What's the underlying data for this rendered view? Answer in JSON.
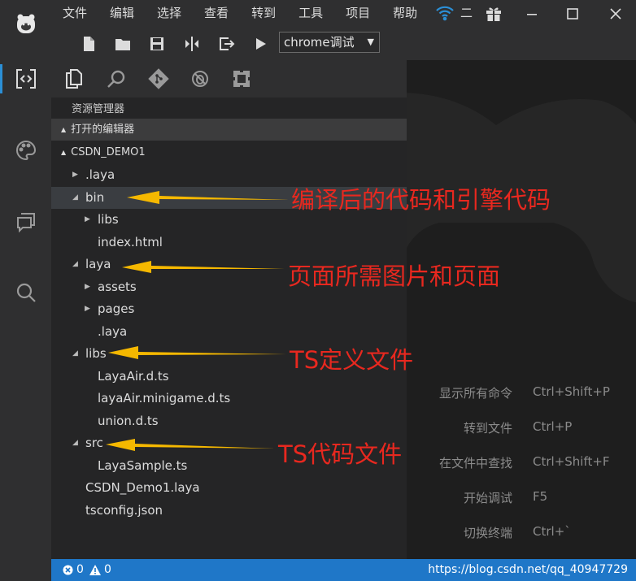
{
  "menu": [
    "文件",
    "编辑",
    "选择",
    "查看",
    "转到",
    "工具",
    "项目",
    "帮助"
  ],
  "title_extra": "二",
  "toolbar": {
    "run_config": "chrome调试"
  },
  "explorer": {
    "title": "资源管理器",
    "open_editors": "打开的编辑器",
    "project": "CSDN_DEMO1",
    "tree": [
      {
        "label": ".laya",
        "depth": 0,
        "caret": "closed"
      },
      {
        "label": "bin",
        "depth": 0,
        "caret": "open",
        "selected": true
      },
      {
        "label": "libs",
        "depth": 1,
        "caret": "closed"
      },
      {
        "label": "index.html",
        "depth": 1,
        "caret": "none"
      },
      {
        "label": "laya",
        "depth": 0,
        "caret": "open"
      },
      {
        "label": "assets",
        "depth": 1,
        "caret": "closed"
      },
      {
        "label": "pages",
        "depth": 1,
        "caret": "closed"
      },
      {
        "label": ".laya",
        "depth": 1,
        "caret": "none"
      },
      {
        "label": "libs",
        "depth": 0,
        "caret": "open"
      },
      {
        "label": "LayaAir.d.ts",
        "depth": 1,
        "caret": "none"
      },
      {
        "label": "layaAir.minigame.d.ts",
        "depth": 1,
        "caret": "none"
      },
      {
        "label": "union.d.ts",
        "depth": 1,
        "caret": "none"
      },
      {
        "label": "src",
        "depth": 0,
        "caret": "open"
      },
      {
        "label": "LayaSample.ts",
        "depth": 1,
        "caret": "none"
      },
      {
        "label": "CSDN_Demo1.laya",
        "depth": 0,
        "caret": "none"
      },
      {
        "label": "tsconfig.json",
        "depth": 0,
        "caret": "none"
      }
    ]
  },
  "hints": [
    {
      "label": "显示所有命令",
      "key": "Ctrl+Shift+P"
    },
    {
      "label": "转到文件",
      "key": "Ctrl+P"
    },
    {
      "label": "在文件中查找",
      "key": "Ctrl+Shift+F"
    },
    {
      "label": "开始调试",
      "key": "F5"
    },
    {
      "label": "切换终端",
      "key": "Ctrl+`"
    }
  ],
  "status": {
    "errors": "0",
    "warnings": "0",
    "watermark_url": "https://blog.csdn.net/qq_40947729"
  },
  "annotations": {
    "bin": "编译后的代码和引擎代码",
    "laya": "页面所需图片和页面",
    "libs": "TS定义文件",
    "src": "TS代码文件"
  },
  "colors": {
    "statusbar": "#1f77c8",
    "accent": "#2b8fd6",
    "annotation_text": "#e8281f",
    "annotation_arrow": "#f5b800"
  }
}
